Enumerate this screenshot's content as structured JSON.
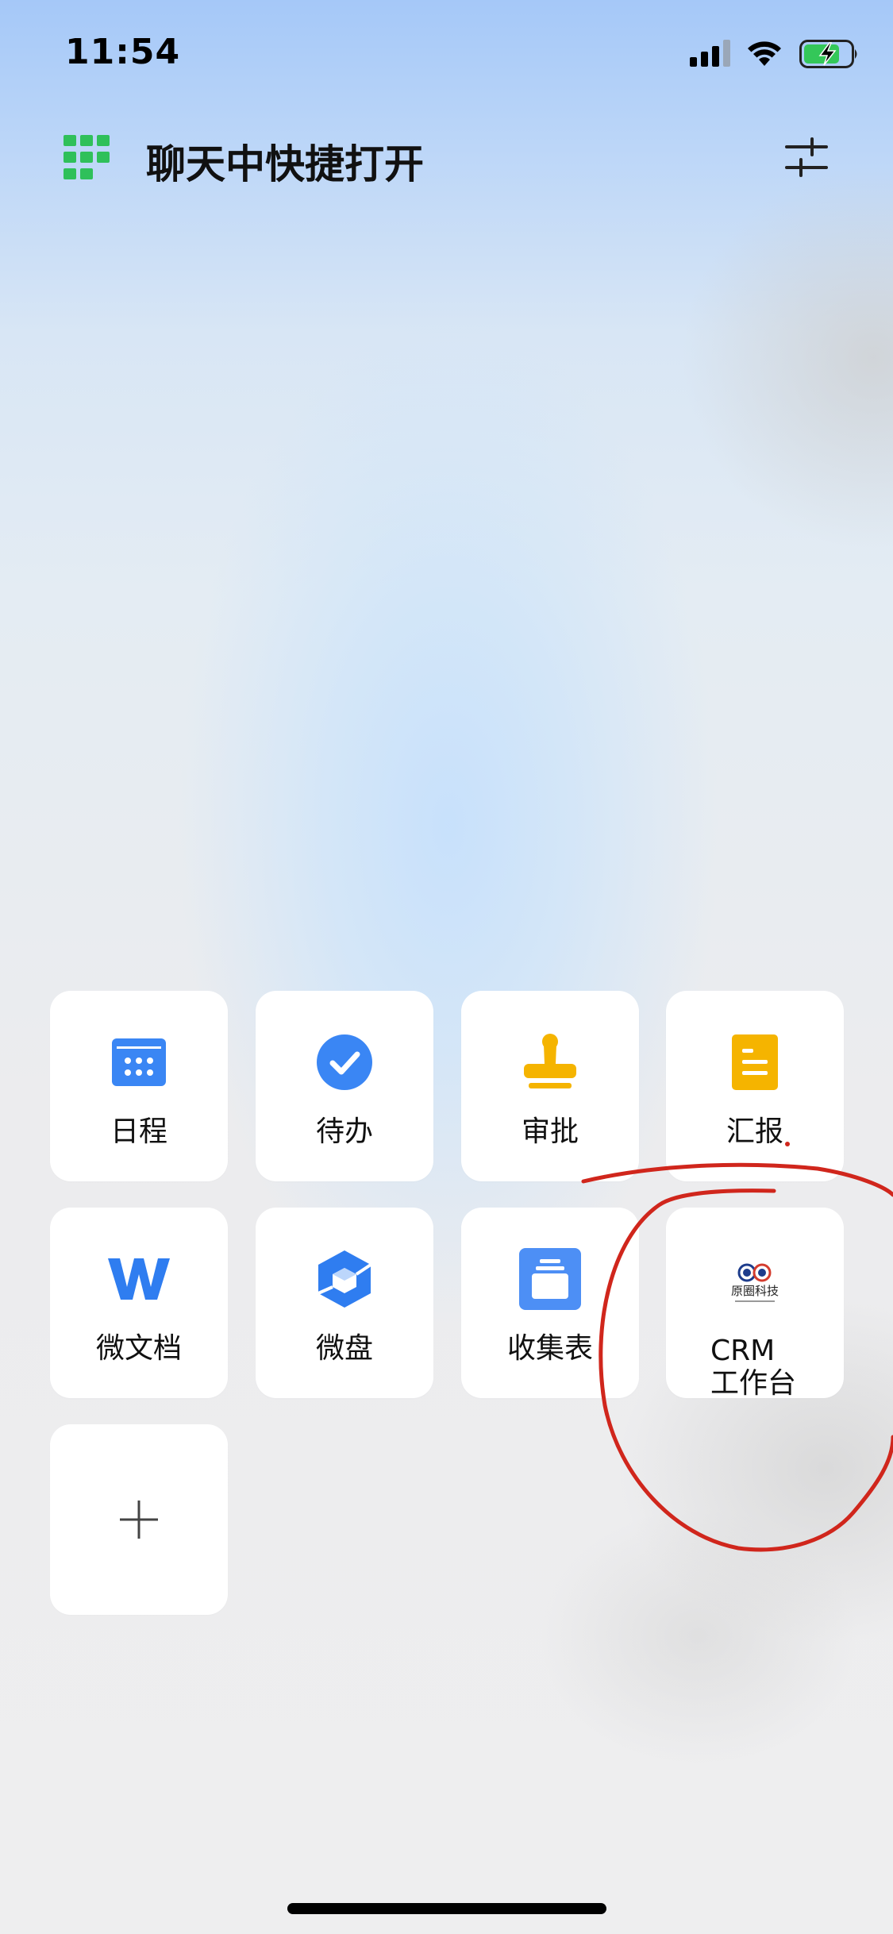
{
  "status_bar": {
    "time": "11:54"
  },
  "header": {
    "title": "聊天中快捷打开"
  },
  "tiles": [
    {
      "label": "日程",
      "icon": "calendar-icon",
      "color": "#3a86f4"
    },
    {
      "label": "待办",
      "icon": "checkmark-icon",
      "color": "#3a86f4"
    },
    {
      "label": "审批",
      "icon": "stamp-icon",
      "color": "#f5b400"
    },
    {
      "label": "汇报",
      "icon": "report-icon",
      "color": "#f5b400"
    },
    {
      "label": "微文档",
      "icon": "w-doc-icon",
      "color": "#2f7df0"
    },
    {
      "label": "微盘",
      "icon": "cube-icon",
      "color": "#2f7df0"
    },
    {
      "label": "收集表",
      "icon": "form-icon",
      "color": "#4d8ff5"
    },
    {
      "label_line1": "CRM",
      "label_line2": "工作台",
      "icon": "company-logo-icon",
      "logo_text": "原圈科技"
    }
  ],
  "add_tile": {
    "icon": "plus-icon"
  },
  "annotation_color": "#d0261c"
}
